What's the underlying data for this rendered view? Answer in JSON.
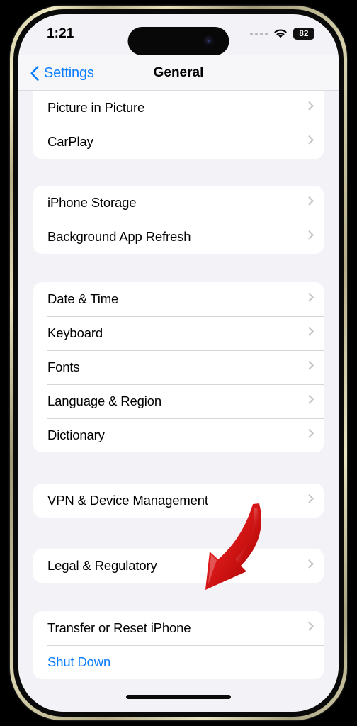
{
  "status_bar": {
    "time": "1:21",
    "cellular_icon": "signal-dots-icon",
    "wifi_icon": "wifi-icon",
    "battery_level": "82",
    "battery_icon": "battery-icon"
  },
  "nav_bar": {
    "back_label": "Settings",
    "back_icon": "chevron-left-icon",
    "title": "General"
  },
  "colors": {
    "accent_blue": "#0a7cff",
    "background": "#f2f2f7",
    "card": "#ffffff",
    "chevron": "#c3c3c8",
    "annotation_red": "#e01b1b"
  },
  "groups": [
    {
      "id": "media-group",
      "clipped_top": true,
      "rows": [
        {
          "label": "Picture in Picture",
          "type": "disclosure",
          "accessory": "chevron-right-icon"
        },
        {
          "label": "CarPlay",
          "type": "disclosure",
          "accessory": "chevron-right-icon"
        }
      ]
    },
    {
      "id": "storage-group",
      "clipped_top": false,
      "rows": [
        {
          "label": "iPhone Storage",
          "type": "disclosure",
          "accessory": "chevron-right-icon"
        },
        {
          "label": "Background App Refresh",
          "type": "disclosure",
          "accessory": "chevron-right-icon"
        }
      ]
    },
    {
      "id": "localization-group",
      "clipped_top": false,
      "rows": [
        {
          "label": "Date & Time",
          "type": "disclosure",
          "accessory": "chevron-right-icon"
        },
        {
          "label": "Keyboard",
          "type": "disclosure",
          "accessory": "chevron-right-icon"
        },
        {
          "label": "Fonts",
          "type": "disclosure",
          "accessory": "chevron-right-icon"
        },
        {
          "label": "Language & Region",
          "type": "disclosure",
          "accessory": "chevron-right-icon"
        },
        {
          "label": "Dictionary",
          "type": "disclosure",
          "accessory": "chevron-right-icon"
        }
      ]
    },
    {
      "id": "vpn-group",
      "clipped_top": false,
      "rows": [
        {
          "label": "VPN & Device Management",
          "type": "disclosure",
          "accessory": "chevron-right-icon"
        }
      ]
    },
    {
      "id": "legal-group",
      "clipped_top": false,
      "rows": [
        {
          "label": "Legal & Regulatory",
          "type": "disclosure",
          "accessory": "chevron-right-icon"
        }
      ]
    },
    {
      "id": "reset-group",
      "clipped_top": false,
      "rows": [
        {
          "label": "Transfer or Reset iPhone",
          "type": "disclosure",
          "accessory": "chevron-right-icon"
        },
        {
          "label": "Shut Down",
          "type": "action",
          "accessory": "none"
        }
      ]
    }
  ],
  "annotation": {
    "type": "curved-arrow",
    "color": "#e01b1b",
    "points_to": "Transfer or Reset iPhone"
  }
}
